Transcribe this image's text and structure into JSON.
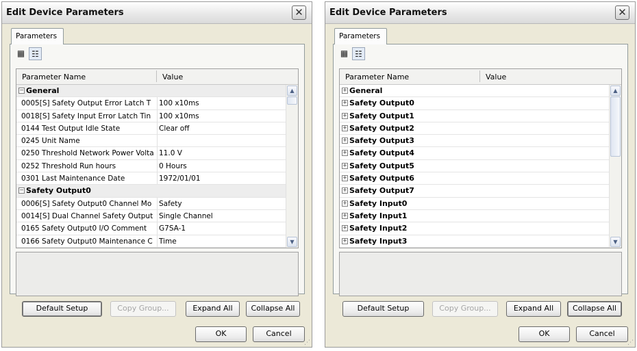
{
  "dialogs": [
    {
      "title": "Edit Device Parameters",
      "close_glyph": "✕",
      "tab_label": "Parameters",
      "toolbar_icons": [
        "table-view-icon",
        "list-view-icon"
      ],
      "columns": [
        "Parameter Name",
        "Value"
      ],
      "rows": [
        {
          "type": "group",
          "expander": "−",
          "name": "General"
        },
        {
          "type": "param",
          "name": "0005[S] Safety Output Error Latch T",
          "value": "100 x10ms"
        },
        {
          "type": "param",
          "name": "0018[S] Safety Input Error Latch Tin",
          "value": "100 x10ms"
        },
        {
          "type": "param",
          "name": "0144 Test Output Idle State",
          "value": "Clear off"
        },
        {
          "type": "param",
          "name": "0245 Unit Name",
          "value": ""
        },
        {
          "type": "param",
          "name": "0250 Threshold Network Power Volta",
          "value": "11.0 V"
        },
        {
          "type": "param",
          "name": "0252 Threshold Run hours",
          "value": "0 Hours"
        },
        {
          "type": "param",
          "name": "0301 Last Maintenance Date",
          "value": "1972/01/01"
        },
        {
          "type": "group",
          "expander": "−",
          "name": "Safety Output0"
        },
        {
          "type": "param",
          "name": "0006[S] Safety Output0 Channel Mo",
          "value": "Safety"
        },
        {
          "type": "param",
          "name": "0014[S] Dual Channel Safety Output",
          "value": "Single Channel"
        },
        {
          "type": "param",
          "name": "0165 Safety Output0 I/O Comment",
          "value": "G7SA-1"
        },
        {
          "type": "param",
          "name": "0166 Safety Output0 Maintenance C",
          "value": "Time"
        }
      ],
      "scroll": {
        "up": "▲",
        "down": "▼",
        "thumb_start": 0.0,
        "thumb_fraction": 0.06
      },
      "buttons": {
        "default_setup": "Default Setup",
        "copy_group": "Copy Group...",
        "expand_all": "Expand All",
        "collapse_all": "Collapse All",
        "ok": "OK",
        "cancel": "Cancel"
      }
    },
    {
      "title": "Edit Device Parameters",
      "close_glyph": "✕",
      "tab_label": "Parameters",
      "toolbar_icons": [
        "table-view-icon",
        "list-view-icon"
      ],
      "columns": [
        "Parameter Name",
        "Value"
      ],
      "rows": [
        {
          "type": "group",
          "expander": "+",
          "name": "General"
        },
        {
          "type": "group",
          "expander": "+",
          "name": "Safety Output0"
        },
        {
          "type": "group",
          "expander": "+",
          "name": "Safety Output1"
        },
        {
          "type": "group",
          "expander": "+",
          "name": "Safety Output2"
        },
        {
          "type": "group",
          "expander": "+",
          "name": "Safety Output3"
        },
        {
          "type": "group",
          "expander": "+",
          "name": "Safety Output4"
        },
        {
          "type": "group",
          "expander": "+",
          "name": "Safety Output5"
        },
        {
          "type": "group",
          "expander": "+",
          "name": "Safety Output6"
        },
        {
          "type": "group",
          "expander": "+",
          "name": "Safety Output7"
        },
        {
          "type": "group",
          "expander": "+",
          "name": "Safety Input0"
        },
        {
          "type": "group",
          "expander": "+",
          "name": "Safety Input1"
        },
        {
          "type": "group",
          "expander": "+",
          "name": "Safety Input2"
        },
        {
          "type": "group",
          "expander": "+",
          "name": "Safety Input3"
        }
      ],
      "scroll": {
        "up": "▲",
        "down": "▼",
        "thumb_start": 0.0,
        "thumb_fraction": 0.43
      },
      "buttons": {
        "default_setup": "Default Setup",
        "copy_group": "Copy Group...",
        "expand_all": "Expand All",
        "collapse_all": "Collapse All",
        "ok": "OK",
        "cancel": "Cancel"
      }
    }
  ]
}
